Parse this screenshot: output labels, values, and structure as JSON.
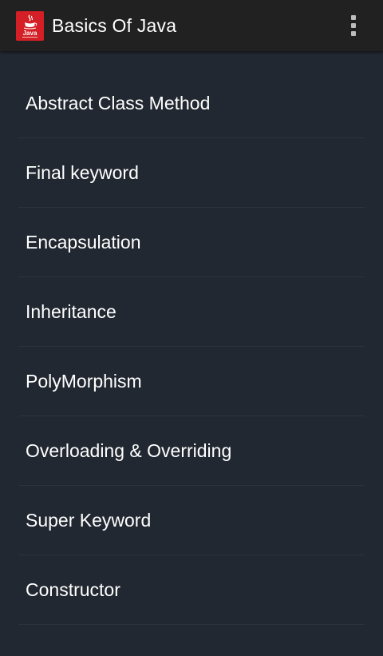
{
  "appbar": {
    "title": "Basics Of Java",
    "icon": "java-logo-icon",
    "icon_text": "Java",
    "icon_color": "#d31f25",
    "menu_icon": "overflow-menu-icon"
  },
  "topics": [
    {
      "label": "Abstract Class Method"
    },
    {
      "label": "Final keyword"
    },
    {
      "label": "Encapsulation"
    },
    {
      "label": "Inheritance"
    },
    {
      "label": "PolyMorphism"
    },
    {
      "label": "Overloading & Overriding"
    },
    {
      "label": "Super Keyword"
    },
    {
      "label": "Constructor"
    }
  ],
  "colors": {
    "appbar_bg": "#212121",
    "list_bg": "#222831",
    "text": "#ffffff",
    "divider": "#2c333c"
  }
}
